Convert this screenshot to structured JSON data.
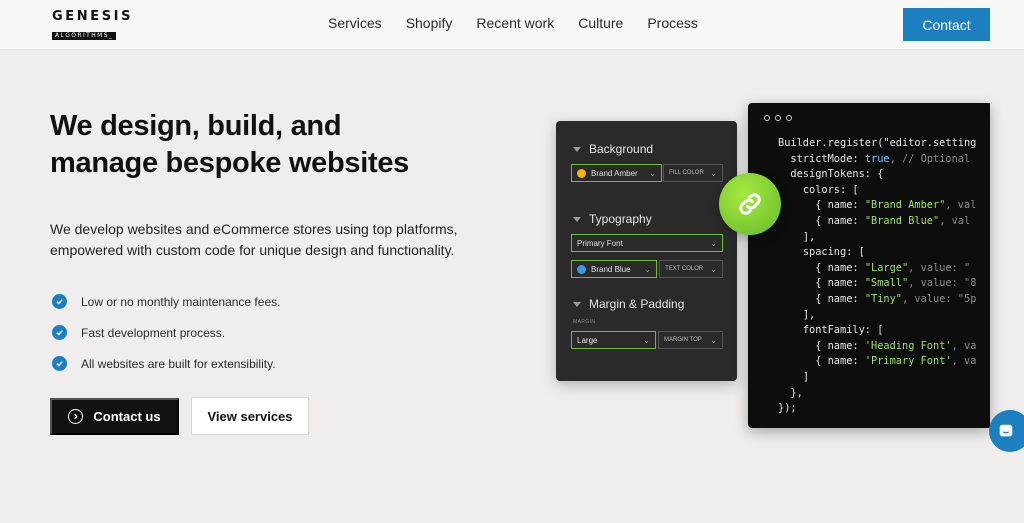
{
  "header": {
    "logo_top": "GENESIS",
    "logo_bottom": "ALGORITHMS_",
    "nav": [
      "Services",
      "Shopify",
      "Recent work",
      "Culture",
      "Process"
    ],
    "contact_label": "Contact"
  },
  "hero": {
    "title_line1": "We design, build, and",
    "title_line2": "manage bespoke websites",
    "desc_line1": "We develop websites and eCommerce stores using top platforms,",
    "desc_line2": "empowered with custom code for unique design and functionality.",
    "features": [
      "Low or no monthly maintenance fees.",
      "Fast development process.",
      "All websites are built for extensibility."
    ],
    "primary_cta": "Contact us",
    "secondary_cta": "View services"
  },
  "panel": {
    "background": {
      "heading": "Background",
      "color_label": "Brand Amber",
      "color_hex": "#f5b400",
      "property": "FILL COLOR"
    },
    "typography": {
      "heading": "Typography",
      "font": "Primary Font",
      "color_label": "Brand Blue",
      "color_hex": "#3a9be0",
      "property": "TEXT COLOR"
    },
    "spacing": {
      "heading": "Margin & Padding",
      "small_label": "MARGIN",
      "size": "Large",
      "property": "MARGIN TOP"
    }
  },
  "code": {
    "line1": "Builder.register(\"editor.setting",
    "line2_key": "strictMode: ",
    "line2_val": "true",
    "line2_comment": ", // Optional",
    "line3": "designTokens: {",
    "line4": "colors: [",
    "line5_pre": "{ name: ",
    "line5_str": "\"Brand Amber\"",
    "line5_post": ", val",
    "line6_pre": "{ name: ",
    "line6_str": "\"Brand Blue\"",
    "line6_post": ", val",
    "line7": "],",
    "line8": "spacing: [",
    "line9_pre": "{ name: ",
    "line9_str": "\"Large\"",
    "line9_post": ", value: \"",
    "line10_pre": "{ name: ",
    "line10_str": "\"Small\"",
    "line10_post": ", value: \"8",
    "line11_pre": "{ name: ",
    "line11_str": "\"Tiny\"",
    "line11_post": ", value: \"5p",
    "line12": "],",
    "line13": "fontFamily: [",
    "line14_pre": "{ name: ",
    "line14_str": "'Heading Font'",
    "line14_post": ", va",
    "line15_pre": "{ name: ",
    "line15_str": "'Primary Font'",
    "line15_post": ", va",
    "line16": "]",
    "line17": "},",
    "line18": "});"
  },
  "colors": {
    "accent": "#1b7fc0",
    "link_green": "#86d235"
  },
  "icons": [
    "check-icon",
    "chevron-right-circle-icon",
    "link-icon",
    "chat-icon",
    "triangle-down-icon",
    "chevron-down-icon"
  ]
}
